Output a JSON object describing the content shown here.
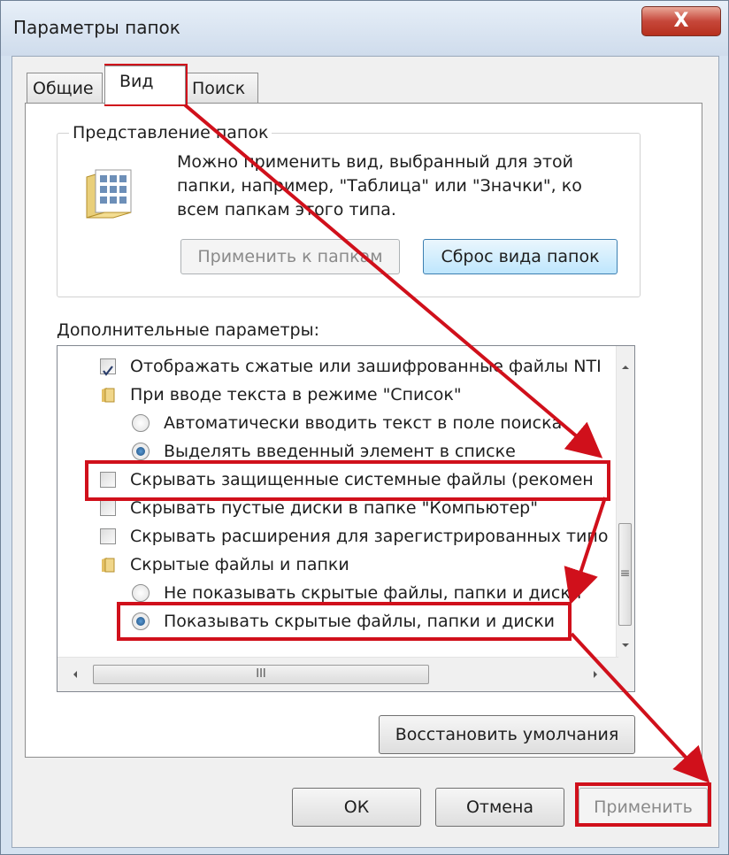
{
  "window": {
    "title": "Параметры папок",
    "close_label": "X"
  },
  "tabs": [
    {
      "label": "Общие",
      "active": false
    },
    {
      "label": "Вид",
      "active": true
    },
    {
      "label": "Поиск",
      "active": false
    }
  ],
  "folder_views": {
    "label": "Представление папок",
    "description": "Можно применить вид, выбранный для этой папки, например, \"Таблица\" или \"Значки\", ко всем папкам этого типа.",
    "apply_label": "Применить к папкам",
    "reset_label": "Сброс вида папок"
  },
  "advanced": {
    "label": "Дополнительные параметры:",
    "items": [
      {
        "type": "checkbox",
        "checked": true,
        "label": "Отображать сжатые или зашифрованные файлы NTI"
      },
      {
        "type": "folder",
        "label": "При вводе текста в режиме \"Список\""
      },
      {
        "type": "radio",
        "checked": false,
        "label": "Автоматически вводить текст в поле поиска"
      },
      {
        "type": "radio",
        "checked": true,
        "label": "Выделять введенный элемент в списке"
      },
      {
        "type": "checkbox",
        "checked": false,
        "label": "Скрывать защищенные системные файлы (рекомен"
      },
      {
        "type": "checkbox",
        "checked": false,
        "label": "Скрывать пустые диски в папке \"Компьютер\""
      },
      {
        "type": "checkbox",
        "checked": false,
        "label": "Скрывать расширения для зарегистрированных типо"
      },
      {
        "type": "folder",
        "label": "Скрытые файлы и папки"
      },
      {
        "type": "radio",
        "checked": false,
        "label": "Не показывать скрытые файлы, папки и диски"
      },
      {
        "type": "radio",
        "checked": true,
        "label": "Показывать скрытые файлы, папки и диски"
      }
    ],
    "hscroll_grip": "III",
    "vscroll_grip": "≡"
  },
  "restore_label": "Восстановить умолчания",
  "footer": {
    "ok_label": "ОК",
    "cancel_label": "Отмена",
    "apply_label": "Применить"
  },
  "colors": {
    "highlight": "#d0101b",
    "window_frame": "#d5e2f0",
    "panel": "#ffffff"
  }
}
